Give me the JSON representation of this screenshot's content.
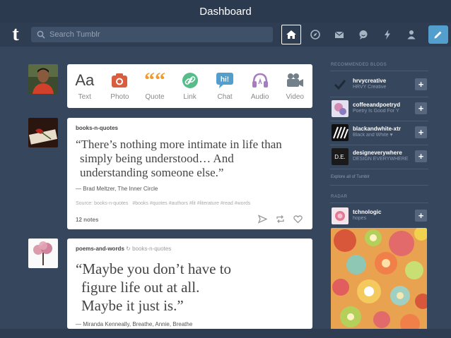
{
  "window": {
    "title": "Dashboard"
  },
  "nav": {
    "logo": "t",
    "search_placeholder": "Search Tumblr",
    "icons": [
      "home-icon",
      "explore-icon",
      "inbox-icon",
      "messages-icon",
      "activity-icon",
      "account-icon"
    ],
    "compose_icon": "pencil-icon"
  },
  "post_types": [
    {
      "label": "Text",
      "glyph": "Aa",
      "color": "#444444"
    },
    {
      "label": "Photo",
      "glyph": "",
      "color": "#d95e40"
    },
    {
      "label": "Quote",
      "glyph": "66",
      "color": "#f2992e"
    },
    {
      "label": "Link",
      "glyph": "",
      "color": "#56bc8a"
    },
    {
      "label": "Chat",
      "glyph": "hi!",
      "color": "#529ecc"
    },
    {
      "label": "Audio",
      "glyph": "",
      "color": "#a77dc2"
    },
    {
      "label": "Video",
      "glyph": "",
      "color": "#748089"
    }
  ],
  "posts": [
    {
      "blog": "books-n-quotes",
      "quote_lines": [
        "“There’s nothing more intimate in life than",
        "simply being understood… And",
        "understanding someone else.”"
      ],
      "attribution": "— Brad Meltzer, The Inner Circle",
      "source": "Source: books-n-quotes",
      "tags": "#books   #quotes   #authors   #lit   #literature   #read   #words",
      "notes": "12 notes"
    },
    {
      "blog": "poems-and-words",
      "reblogged_from": "books-n-quotes",
      "quote_lines": [
        "“Maybe you don’t have to",
        "figure life out at all.",
        "Maybe it just is.”"
      ],
      "attribution": "— Miranda Kenneally, Breathe, Annie, Breathe"
    }
  ],
  "sidebar": {
    "recommended_heading": "RECOMMENDED BLOGS",
    "blogs": [
      {
        "name": "hrvycreative",
        "desc": "HRVY Creative"
      },
      {
        "name": "coffeeandpoetryd",
        "desc": "Poetry Is Good For Y"
      },
      {
        "name": "blackandwhite-xtr",
        "desc": "Black and White ♥"
      },
      {
        "name": "designeverywhere",
        "desc": "DESIGN EVERYWHERE",
        "thumb_text": "D.E."
      }
    ],
    "explore_link": "Explore all of Tumblr",
    "radar_heading": "RADAR",
    "radar_blog": {
      "name": "tchnologic",
      "desc": "hopes"
    },
    "follow_glyph": "+"
  }
}
